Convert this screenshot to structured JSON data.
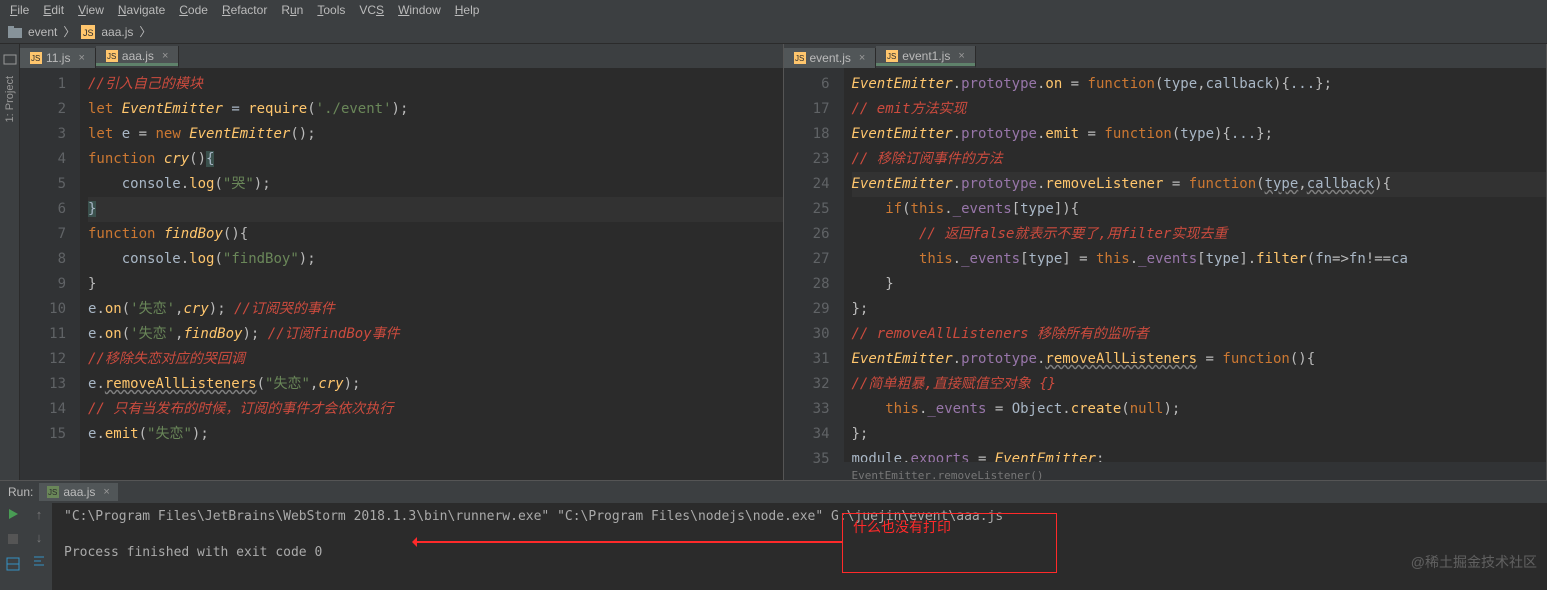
{
  "menu": {
    "items": [
      "File",
      "Edit",
      "View",
      "Navigate",
      "Code",
      "Refactor",
      "Run",
      "Tools",
      "VCS",
      "Window",
      "Help"
    ],
    "underlines": [
      "F",
      "E",
      "V",
      "N",
      "C",
      "R",
      "u",
      "T",
      "S",
      "W",
      "H"
    ]
  },
  "breadcrumb": {
    "folder": "event",
    "file": "aaa.js"
  },
  "side_rail": {
    "label": "1: Project"
  },
  "left": {
    "tabs": [
      {
        "name": "11.js",
        "active": false
      },
      {
        "name": "aaa.js",
        "active": true
      }
    ],
    "lines": [
      {
        "n": 1,
        "html": "<span class='c-comment'>//引入自己的模块</span>"
      },
      {
        "n": 2,
        "html": "<span class='c-keyword'>let</span> <span class='c-def'>EventEmitter</span> <span class='c-ident'>=</span> <span class='c-fn'>require</span>(<span class='c-str'>'./event'</span>);"
      },
      {
        "n": 3,
        "html": "<span class='c-keyword'>let</span> <span class='c-ident'>e</span> = <span class='c-keyword'>new</span> <span class='c-def'>EventEmitter</span>();"
      },
      {
        "n": 4,
        "html": "<span class='c-keyword'>function</span> <span class='c-def'>cry</span>()<span class='c-brace c-brace-match'>{</span>"
      },
      {
        "n": 5,
        "html": "    <span class='c-ident'>console</span>.<span class='c-fn'>log</span>(<span class='c-str'>\"哭\"</span>);"
      },
      {
        "n": 6,
        "html": "<span class='c-brace c-brace-match'>}</span>",
        "caret": true
      },
      {
        "n": 7,
        "html": "<span class='c-keyword'>function</span> <span class='c-def'>findBoy</span>(){"
      },
      {
        "n": 8,
        "html": "    <span class='c-ident'>console</span>.<span class='c-fn'>log</span>(<span class='c-str'>\"findBoy\"</span>);"
      },
      {
        "n": 9,
        "html": "}"
      },
      {
        "n": 10,
        "html": "<span class='c-ident'>e</span>.<span class='c-fn'>on</span>(<span class='c-str'>'失恋'</span>,<span class='c-def'>cry</span>); <span class='c-comment'>//订阅哭的事件</span>"
      },
      {
        "n": 11,
        "html": "<span class='c-ident'>e</span>.<span class='c-fn'>on</span>(<span class='c-str'>'失恋'</span>,<span class='c-def'>findBoy</span>); <span class='c-comment'>//订阅findBoy事件</span>"
      },
      {
        "n": 12,
        "html": "<span class='c-comment'>//移除失恋对应的哭回调</span>"
      },
      {
        "n": 13,
        "html": "<span class='c-ident'>e</span>.<span class='c-fn c-warn'>removeAllListeners</span>(<span class='c-str'>\"失恋\"</span>,<span class='c-def'>cry</span>);"
      },
      {
        "n": 14,
        "html": "<span class='c-comment'>// 只有当发布的时候，订阅的事件才会依次执行</span>"
      },
      {
        "n": 15,
        "html": "<span class='c-ident'>e</span>.<span class='c-fn'>emit</span>(<span class='c-str'>\"失恋\"</span>);"
      }
    ]
  },
  "right": {
    "tabs": [
      {
        "name": "event.js",
        "active": false
      },
      {
        "name": "event1.js",
        "active": true
      }
    ],
    "lines": [
      {
        "n": 6,
        "html": "<span class='c-def'>EventEmitter</span>.<span class='c-prop'>prototype</span>.<span class='c-fn'>on</span> = <span class='c-keyword'>function</span>(<span class='c-ident'>type</span>,<span class='c-ident'>callback</span>){<span class='c-ident'>...</span>};"
      },
      {
        "n": 17,
        "html": "<span class='c-comment'>// emit方法实现</span>"
      },
      {
        "n": 18,
        "html": "<span class='c-def'>EventEmitter</span>.<span class='c-prop'>prototype</span>.<span class='c-fn'>emit</span> = <span class='c-keyword'>function</span>(<span class='c-ident'>type</span>){<span class='c-ident'>...</span>};"
      },
      {
        "n": 23,
        "html": "<span class='c-comment'>// 移除订阅事件的方法</span>"
      },
      {
        "n": 24,
        "html": "<span class='c-def'>EventEmitter</span>.<span class='c-prop'>prototype</span>.<span class='c-fn'>removeListener</span> = <span class='c-keyword'>function</span>(<span class='c-ident c-warn'>type</span>,<span class='c-ident c-warn'>callback</span>){",
        "hl": true
      },
      {
        "n": 25,
        "html": "    <span class='c-keyword'>if</span>(<span class='c-keyword'>this</span>.<span class='c-prop'>_events</span>[<span class='c-ident'>type</span>]){"
      },
      {
        "n": 26,
        "html": "        <span class='c-comment'>// 返回false就表示不要了,用filter实现去重</span>"
      },
      {
        "n": 27,
        "html": "        <span class='c-keyword'>this</span>.<span class='c-prop'>_events</span>[<span class='c-ident'>type</span>] = <span class='c-keyword'>this</span>.<span class='c-prop'>_events</span>[<span class='c-ident'>type</span>].<span class='c-fn'>filter</span>(<span class='c-ident'>fn</span>=&gt;<span class='c-ident'>fn</span>!==<span class='c-ident'>ca</span>"
      },
      {
        "n": 28,
        "html": "    }"
      },
      {
        "n": 29,
        "html": "};"
      },
      {
        "n": 30,
        "html": "<span class='c-comment'>// removeAllListeners 移除所有的监听者</span>"
      },
      {
        "n": 31,
        "html": "<span class='c-def'>EventEmitter</span>.<span class='c-prop'>prototype</span>.<span class='c-fn c-warn'>removeAllListeners</span> = <span class='c-keyword'>function</span>(){"
      },
      {
        "n": 32,
        "html": "<span class='c-comment'>//简单粗暴,直接赋值空对象 {}</span>"
      },
      {
        "n": 33,
        "html": "    <span class='c-keyword'>this</span>.<span class='c-prop'>_events</span> = <span class='c-ident'>Object</span>.<span class='c-fn'>create</span>(<span class='c-keyword'>null</span>);"
      },
      {
        "n": 34,
        "html": "};"
      },
      {
        "n": 35,
        "html": "<span class='c-ident'>module</span>.<span class='c-prop'>exports</span> = <span class='c-def'>EventEmitter</span>;"
      }
    ],
    "mini_breadcrumb": "EventEmitter.removeListener()"
  },
  "run": {
    "label": "Run:",
    "tab": "aaa.js",
    "console": [
      "\"C:\\Program Files\\JetBrains\\WebStorm 2018.1.3\\bin\\runnerw.exe\" \"C:\\Program Files\\nodejs\\node.exe\" G:\\juejin\\event\\aaa.js",
      "",
      "Process finished with exit code 0"
    ]
  },
  "annotation": {
    "text": "什么也没有打印"
  },
  "watermark": "@稀土掘金技术社区"
}
